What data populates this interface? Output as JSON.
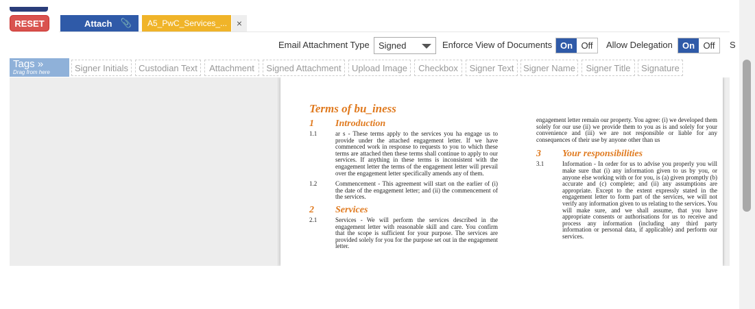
{
  "toolbar": {
    "reset_label": "RESET",
    "attach_label": "Attach",
    "file_chip_label": "A5_PwC_Services_...",
    "file_close_label": "×"
  },
  "options": {
    "email_type_label": "Email Attachment Type",
    "email_type_value": "Signed",
    "enforce_view_label": "Enforce View of Documents",
    "allow_delegation_label": "Allow Delegation",
    "on_label": "On",
    "off_label": "Off",
    "edge_char": "S"
  },
  "tags": {
    "header": "Tags »",
    "subheader": "Drag from here",
    "items": [
      "Signer Initials",
      "Custodian Text",
      "Attachment",
      "Signed Attachment",
      "Upload Image",
      "Checkbox",
      "Signer Text",
      "Signer Name",
      "Signer Title",
      "Signature"
    ]
  },
  "document": {
    "title": "Terms of bu_iness",
    "col1": {
      "sec1_num": "1",
      "sec1_title": "Introduction",
      "p11_num": "1.1",
      "p11_text": "ar s - These terms apply to the services you ha engage us to provide under the attached engagement letter. If we have commenced work in response to requests to you to which these terms are attached then these terms shall continue to apply to our services. If anything in these terms is inconsistent with the engagement letter the terms of the engagement letter will prevail over the engagement letter specifically amends any of them.",
      "p12_num": "1.2",
      "p12_text": "Commencement - This agreement will start on the earlier of (i) the date of the engagement letter; and (ii) the commencement of the services.",
      "sec2_num": "2",
      "sec2_title": "Services",
      "p21_num": "2.1",
      "p21_text": "Services - We will perform the services described in the engagement letter with reasonable skill and care. You confirm that the scope is sufficient for your purpose. The services are provided solely for you for the purpose set out in the engagement letter."
    },
    "col2": {
      "p_top": "engagement letter remain our property. You agree: (i) we developed them solely for our use (ii) we provide them to you as is and solely for your convenience and (iii) we are not responsible or liable for any consequences of their use by anyone other than us",
      "sec3_num": "3",
      "sec3_title": "Your responsibilities",
      "p31_num": "3.1",
      "p31_text": "Information - In order for us to advise you properly you will make sure that (i) any information given to us by you, or anyone else working with or for you, is (a) given promptly (b) accurate and (c) complete; and (ii) any assumptions are appropriate. Except to the extent expressly stated in the engagement letter to form part of the services, we will not verify any information given to us relating to the services. You will make sure, and we shall assume, that you have appropriate consents or authorisations for us to receive and process any information (including any third party information or personal data, if applicable) and perform our services."
    }
  }
}
